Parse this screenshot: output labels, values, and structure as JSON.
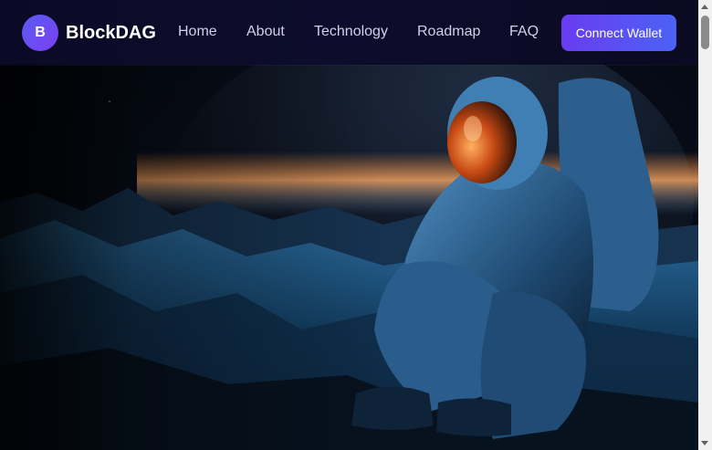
{
  "brand": {
    "logo_letter": "B",
    "name": "BlockDAG"
  },
  "nav": {
    "links": [
      "Home",
      "About",
      "Technology",
      "Roadmap",
      "FAQ"
    ],
    "cta_label": "Connect Wallet"
  },
  "colors": {
    "nav_background": "#0c0b2a",
    "accent_start": "#6a3cf0",
    "accent_end": "#4b62f5",
    "nav_link": "#cfd1e6",
    "hero_glow": "#f08a3c"
  },
  "hero": {
    "image": "astronaut-sitting-on-alien-planet"
  },
  "icons": {
    "scroll_up": "scroll-up-arrow-icon",
    "scroll_down": "scroll-down-arrow-icon"
  }
}
